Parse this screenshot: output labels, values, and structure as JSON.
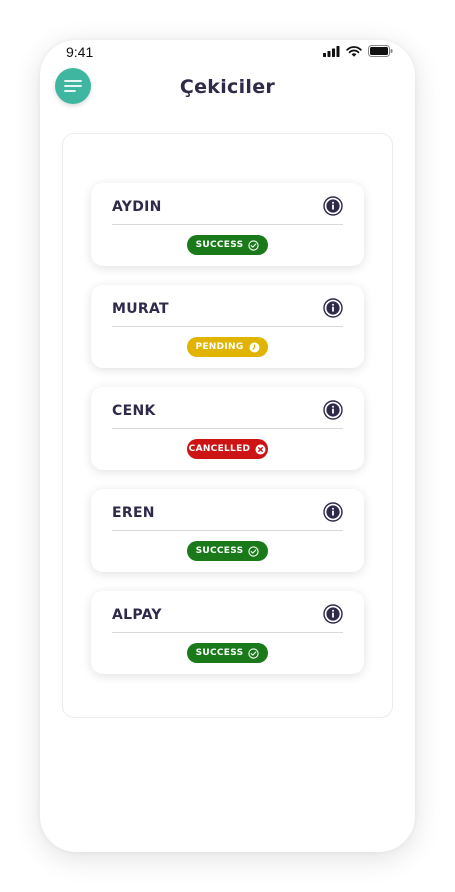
{
  "status_bar": {
    "time": "9:41"
  },
  "header": {
    "title": "Çekiciler"
  },
  "colors": {
    "accent": "#3fb7a0",
    "title": "#2f2a4a",
    "success": "#1a7a1a",
    "pending": "#e0b400",
    "cancelled": "#cc1414"
  },
  "items": [
    {
      "name": "AYDIN",
      "status": "SUCCESS",
      "status_type": "success",
      "status_icon": "check-circle-icon"
    },
    {
      "name": "MURAT",
      "status": "PENDING",
      "status_type": "pending",
      "status_icon": "clock-icon"
    },
    {
      "name": "CENK",
      "status": "CANCELLED",
      "status_type": "cancelled",
      "status_icon": "x-circle-icon"
    },
    {
      "name": "EREN",
      "status": "SUCCESS",
      "status_type": "success",
      "status_icon": "check-circle-icon"
    },
    {
      "name": "ALPAY",
      "status": "SUCCESS",
      "status_type": "success",
      "status_icon": "check-circle-icon"
    }
  ]
}
